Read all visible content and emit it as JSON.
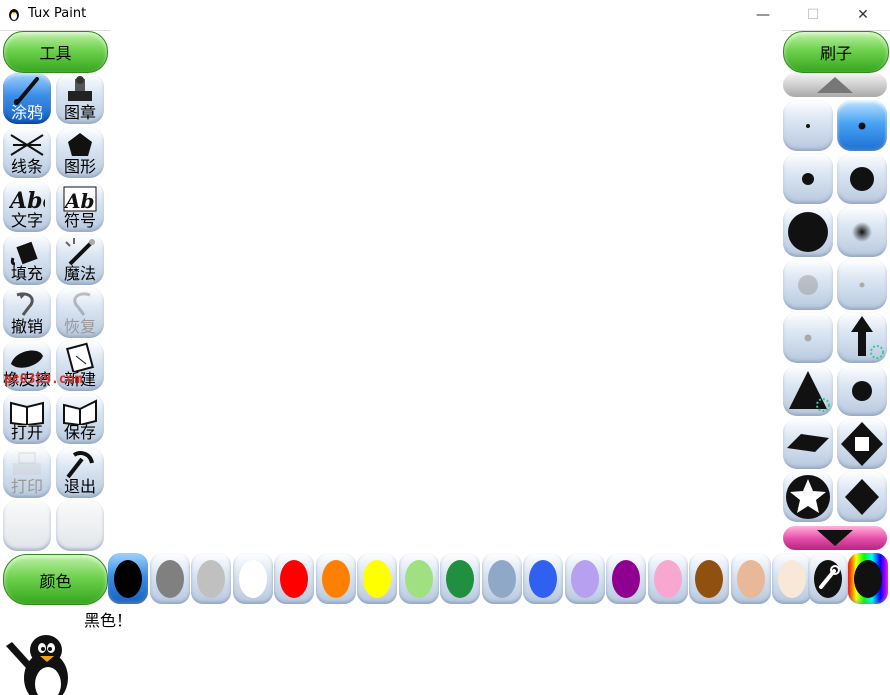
{
  "window": {
    "title": "Tux Paint",
    "minimize": "—",
    "maximize": "☐",
    "close": "✕"
  },
  "tools_header": "工具",
  "brushes_header": "刷子",
  "colors_header": "颜色",
  "tools": [
    {
      "label": "涂鸦",
      "icon": "paintbrush-icon",
      "state": "active"
    },
    {
      "label": "图章",
      "icon": "stamp-icon",
      "state": "normal"
    },
    {
      "label": "线条",
      "icon": "lines-icon",
      "state": "normal"
    },
    {
      "label": "图形",
      "icon": "pentagon-icon",
      "state": "normal"
    },
    {
      "label": "文字",
      "icon": "text-abc-icon",
      "state": "normal"
    },
    {
      "label": "符号",
      "icon": "label-abc-icon",
      "state": "normal"
    },
    {
      "label": "填充",
      "icon": "paint-bucket-icon",
      "state": "normal"
    },
    {
      "label": "魔法",
      "icon": "magic-wand-icon",
      "state": "normal"
    },
    {
      "label": "撤销",
      "icon": "undo-icon",
      "state": "normal"
    },
    {
      "label": "恢复",
      "icon": "redo-icon",
      "state": "disabled"
    },
    {
      "label": "橡皮擦",
      "icon": "eraser-icon",
      "state": "normal"
    },
    {
      "label": "新建",
      "icon": "new-document-icon",
      "state": "normal"
    },
    {
      "label": "打开",
      "icon": "open-book-icon",
      "state": "normal"
    },
    {
      "label": "保存",
      "icon": "save-book-icon",
      "state": "normal"
    },
    {
      "label": "打印",
      "icon": "printer-icon",
      "state": "disabled"
    },
    {
      "label": "退出",
      "icon": "quit-icon",
      "state": "normal"
    }
  ],
  "watermark": "pc0359.com",
  "brushes": [
    {
      "icon": "tiny-dot-brush-icon"
    },
    {
      "icon": "small-dot-brush-icon",
      "active": true
    },
    {
      "icon": "medium-dot-brush-icon"
    },
    {
      "icon": "large-dot-brush-icon"
    },
    {
      "icon": "xlarge-dot-brush-icon"
    },
    {
      "icon": "fuzzy-dot-brush-icon"
    },
    {
      "icon": "soft-gray-brush-icon"
    },
    {
      "icon": "faint-dot-brush-icon"
    },
    {
      "icon": "faint-small-brush-icon"
    },
    {
      "icon": "arrow-up-brush-icon"
    },
    {
      "icon": "triangle-brush-icon"
    },
    {
      "icon": "circle-brush-icon"
    },
    {
      "icon": "diamond-flat-brush-icon"
    },
    {
      "icon": "square-diamond-brush-icon"
    },
    {
      "icon": "star-brush-icon"
    },
    {
      "icon": "diamond-brush-icon"
    }
  ],
  "colors": [
    {
      "name": "black",
      "hex": "#000000"
    },
    {
      "name": "gray",
      "hex": "#808080"
    },
    {
      "name": "light-gray",
      "hex": "#c0c0c0"
    },
    {
      "name": "white",
      "hex": "#ffffff"
    },
    {
      "name": "red",
      "hex": "#ff0000"
    },
    {
      "name": "orange",
      "hex": "#ff8000"
    },
    {
      "name": "yellow",
      "hex": "#ffff00"
    },
    {
      "name": "light-green",
      "hex": "#a0e080"
    },
    {
      "name": "green",
      "hex": "#209040"
    },
    {
      "name": "steel-blue",
      "hex": "#90a8c8"
    },
    {
      "name": "blue",
      "hex": "#3060f0"
    },
    {
      "name": "lavender",
      "hex": "#b8a0f0"
    },
    {
      "name": "purple",
      "hex": "#900090"
    },
    {
      "name": "pink",
      "hex": "#f8a8d0"
    },
    {
      "name": "brown",
      "hex": "#905010"
    },
    {
      "name": "tan",
      "hex": "#e8b898"
    },
    {
      "name": "cream",
      "hex": "#f8e8d8"
    }
  ],
  "status_text": "黑色！"
}
